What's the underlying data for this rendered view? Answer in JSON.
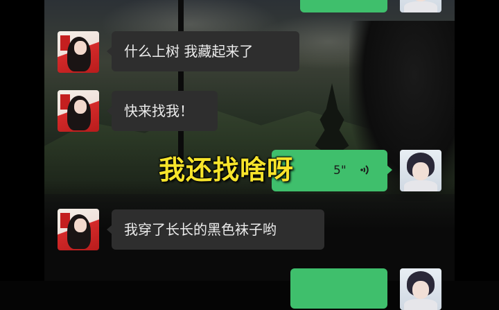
{
  "messages": [
    {
      "id": "m1",
      "side": "incoming",
      "text": "什么上树  我藏起来了"
    },
    {
      "id": "m2",
      "side": "incoming",
      "text": "快来找我！"
    },
    {
      "id": "m3",
      "side": "outgoing",
      "type": "voice",
      "duration": "5\""
    },
    {
      "id": "m4",
      "side": "incoming",
      "text": "我穿了长长的黑色袜子哟"
    }
  ],
  "caption": {
    "text": "我还找啥呀"
  },
  "colors": {
    "incoming_bubble": "#2e2e2e",
    "outgoing_bubble": "#3fbf6c",
    "caption": "#f7e42b"
  },
  "icons": {
    "voice": "voice-wave-icon",
    "avatar_contact": "girl-avatar",
    "avatar_self": "boy-avatar"
  }
}
